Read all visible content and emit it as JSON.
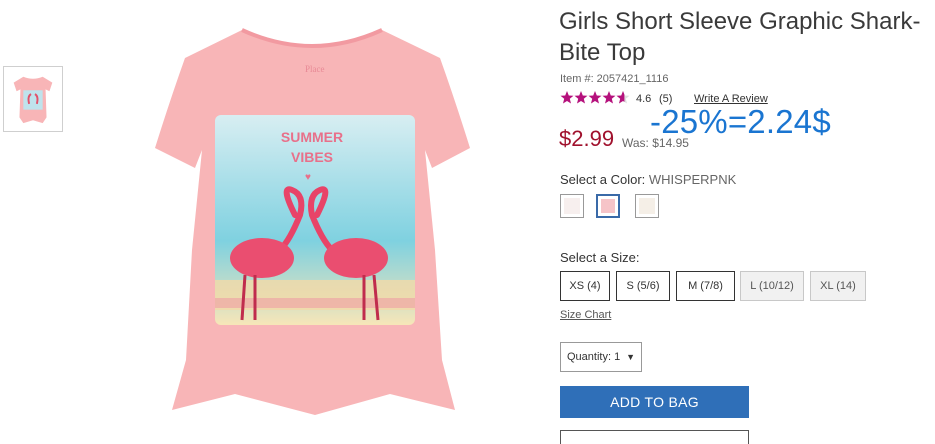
{
  "product": {
    "title": "Girls Short Sleeve Graphic Shark-Bite Top",
    "item_number": "Item #: 2057421_1116",
    "rating_value": "4.6",
    "rating_count": "(5)",
    "rating_stars": 4.6,
    "write_review": "Write A Review",
    "price": "$2.99",
    "was_price": "Was: $14.95",
    "promo_note": "-25%=2.24$",
    "graphic_text_line1": "SUMMER",
    "graphic_text_line2": "VIBES"
  },
  "colors": {
    "label": "Select a Color:",
    "selected": "WHISPERPNK",
    "swatches": [
      {
        "name": "white",
        "fill": "#f7efee"
      },
      {
        "name": "whisperpnk",
        "fill": "#f6c4c8"
      },
      {
        "name": "cream",
        "fill": "#f5efe7"
      }
    ],
    "price_color": "#a0112d",
    "promo_color": "#1a75d1",
    "button_color": "#2f6fb8",
    "shirt_color": "#f8b5b7"
  },
  "sizes": {
    "label": "Select a Size:",
    "options": [
      "XS (4)",
      "S (5/6)",
      "M (7/8)",
      "L (10/12)",
      "XL (14)"
    ],
    "unavailable": [
      "L (10/12)",
      "XL (14)"
    ],
    "size_chart": "Size Chart"
  },
  "quantity": {
    "label": "Quantity: 1",
    "arrow": "▼"
  },
  "actions": {
    "add_to_bag": "ADD TO BAG"
  }
}
